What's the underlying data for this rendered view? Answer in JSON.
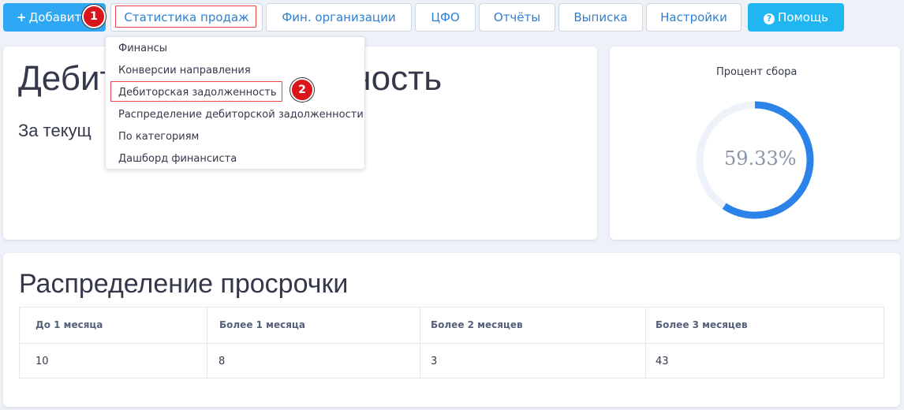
{
  "toolbar": {
    "add_label": "Добавить",
    "sales_stats_label": "Статистика продаж",
    "fin_orgs_label": "Фин. организации",
    "cfo_label": "ЦФО",
    "reports_label": "Отчёты",
    "statement_label": "Выписка",
    "settings_label": "Настройки",
    "help_label": "Помощь"
  },
  "steps": {
    "one": "1",
    "two": "2"
  },
  "dropdown": {
    "items": [
      "Финансы",
      "Конверсии направления",
      "Дебиторская задолженность",
      "Распределение дебиторской задолженности",
      "По категориям",
      "Дашборд финансиста"
    ]
  },
  "main_card": {
    "title_left": "Дебит",
    "title_right": "нность",
    "subtitle": "За текущ"
  },
  "gauge": {
    "label": "Процент сбора",
    "value_text": "59.33%",
    "percent": 59.33,
    "color": "#2b83ea",
    "track_color": "#eef2f9"
  },
  "overdue": {
    "title": "Распределение просрочки",
    "headers": [
      "До 1 месяца",
      "Более 1 месяца",
      "Более 2 месяцев",
      "Более 3 месяцев"
    ],
    "values": [
      "10",
      "8",
      "3",
      "43"
    ]
  }
}
